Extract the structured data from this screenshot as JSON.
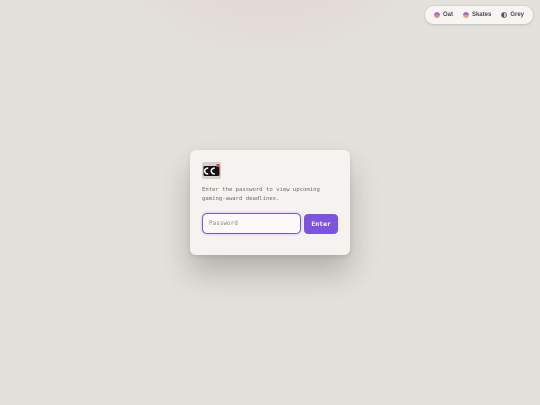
{
  "theme_switcher": {
    "options": [
      {
        "label": "Oat",
        "icon": "oat-swatch-icon"
      },
      {
        "label": "Skates",
        "icon": "skates-swatch-icon"
      },
      {
        "label": "Grey",
        "icon": "grey-swatch-icon"
      }
    ]
  },
  "login_card": {
    "logo_icon": "gaming-logo-icon",
    "message": "Enter the password to view upcoming gaming-award deadlines.",
    "password_placeholder": "Password",
    "enter_label": "Enter"
  },
  "colors": {
    "background": "#e3e1db",
    "card": "#f4f3ef",
    "accent": "#7d54df",
    "text_muted": "#6e6a64"
  }
}
